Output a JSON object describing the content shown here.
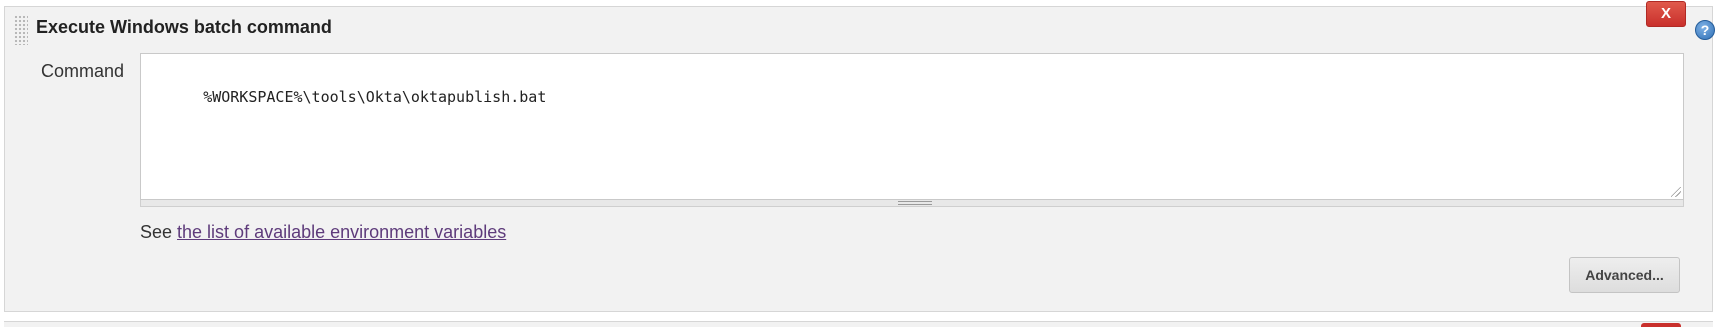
{
  "build_step": {
    "title": "Execute Windows batch command",
    "delete_label": "X",
    "help_label": "?",
    "command": {
      "label": "Command",
      "value": "%WORKSPACE%\\tools\\Okta\\oktapublish.bat"
    },
    "env_hint": {
      "prefix": "See ",
      "link_text": "the list of available environment variables"
    },
    "advanced_label": "Advanced..."
  },
  "colors": {
    "panel_background": "#f2f2f2",
    "delete_button": "#c9302c",
    "link": "#5e3b7b",
    "help_icon": "#2f6fb5"
  },
  "icons": {
    "delete": "close-x-icon",
    "help": "help-question-icon",
    "drag": "drag-handle-icon",
    "resize": "resize-grip-icon"
  }
}
